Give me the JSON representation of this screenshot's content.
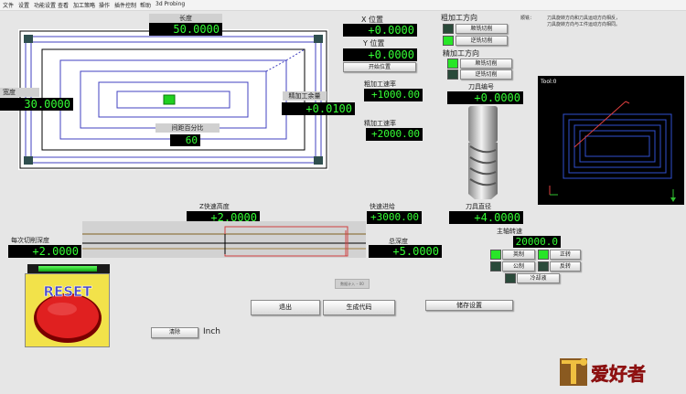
{
  "menu": [
    "文件",
    "设置",
    "功能设置",
    "查看",
    "加工策略",
    "操作",
    "插件控制",
    "帮助",
    "3d Probing"
  ],
  "pocket": {
    "length_label": "长度",
    "length_value": "50.0000",
    "width_label": "宽度",
    "width_value": "30.0000",
    "finish_label": "精加工余量",
    "finish_value": "+0.0100",
    "stepover_label": "间距百分比",
    "stepover_value": "60"
  },
  "position": {
    "x_label": "X 位置",
    "x_value": "+0.0000",
    "y_label": "Y 位置",
    "y_value": "+0.0000",
    "start_button": "开始位置"
  },
  "rough_dir": {
    "title": "粗加工方向",
    "climb": "顺铣切削",
    "conventional": "逆铣切削"
  },
  "finish_dir": {
    "title": "精加工方向",
    "climb": "顺铣切削",
    "conventional": "逆铣切削"
  },
  "notes": {
    "label": "顺铣：",
    "line1": "刀具旋转方向和刀具运动方向相反，",
    "line2": "刀具旋转方向与工件运动方向相同。"
  },
  "feeds": {
    "rough_label": "粗加工速率",
    "rough_value": "+1000.00",
    "finish_label": "精加工速率",
    "finish_value": "+2000.00",
    "tool_label": "刀具编号",
    "tool_value": "+0.0000",
    "tool_dia_label": "刀具直径",
    "tool_dia_value": "+4.0000",
    "rapid_label": "快速进给",
    "rapid_value": "+3000.00",
    "clearance_label": "Z快速高度",
    "clearance_value": "+2.0000",
    "depth_label": "总深度",
    "depth_value": "+5.0000",
    "step_label": "每次切削深度",
    "step_value": "+2.0000"
  },
  "toolpath": {
    "title": "Tool:0"
  },
  "spindle": {
    "label": "主轴转速",
    "value": "20000.0",
    "metric": "英制",
    "imperial": "公制",
    "cw": "正转",
    "ccw": "反转",
    "coolant": "冷却液"
  },
  "actions": {
    "exit": "退出",
    "generate": "生成代码",
    "save": "储存设置",
    "clear": "清除",
    "units": "Inch",
    "small_field": "数据计入 – 00"
  },
  "reset": {
    "label": "RESET"
  },
  "logo": {
    "text": "爱好者"
  },
  "colors": {
    "dro_text": "#35ff35",
    "led_on": "#28e628",
    "reset_red": "#e02020",
    "reset_yellow": "#f2e24a"
  }
}
